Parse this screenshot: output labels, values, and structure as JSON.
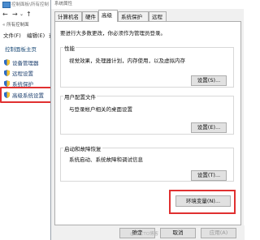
{
  "background_window": {
    "title": "控制面板\\所有控制",
    "nav": {
      "back": "←",
      "forward": "→",
      "up": "↑"
    },
    "breadcrumb": "« 所有控制面",
    "menu": [
      "文件(F)",
      "编辑(E)",
      "查"
    ],
    "home_link": "控制面板主页",
    "links": [
      "设备管理器",
      "远程设置",
      "系统保护",
      "高级系统设置"
    ]
  },
  "dialog": {
    "title": "系统属性",
    "tabs": [
      "计算机名",
      "硬件",
      "高级",
      "系统保护",
      "远程"
    ],
    "active_tab": "高级",
    "admin_note": "要进行大多数更改，你必须作为管理员登录。",
    "performance": {
      "title": "性能",
      "desc": "视觉效果，处理器计划，内存使用，以及虚拟内存",
      "button": "设置(S)..."
    },
    "user_profiles": {
      "title": "用户配置文件",
      "desc": "与登录帐户相关的桌面设置",
      "button": "设置(E)..."
    },
    "startup_recovery": {
      "title": "启动和故障恢复",
      "desc": "系统启动、系统故障和调试信息",
      "button": "设置(T)..."
    },
    "env_button": "环境变量(N)...",
    "bottom_buttons": [
      "确定",
      "取消",
      "应用(A)"
    ]
  },
  "watermark": "@51CTO博客",
  "colors": {
    "highlight": "#e03030",
    "link": "#1c3f6e"
  }
}
